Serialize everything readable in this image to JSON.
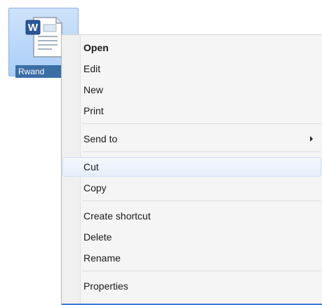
{
  "desktop": {
    "file_label": "Rwand",
    "icon": "word-document-icon",
    "icon_letter": "W"
  },
  "context_menu": {
    "items": [
      {
        "label": "Open"
      },
      {
        "label": "Edit"
      },
      {
        "label": "New"
      },
      {
        "label": "Print"
      },
      {
        "label": "Send to"
      },
      {
        "label": "Cut"
      },
      {
        "label": "Copy"
      },
      {
        "label": "Create shortcut"
      },
      {
        "label": "Delete"
      },
      {
        "label": "Rename"
      },
      {
        "label": "Properties"
      }
    ],
    "bold_item": "Open",
    "hovered_item": "Cut",
    "submenu_item": "Send to",
    "submenu_icon": "chevron-right-icon"
  },
  "colors": {
    "selection": "#a9cdf7",
    "label_highlight": "#3a6ea5",
    "menu_background": "#f5f5f5",
    "accent_line": "#3a7bd5"
  }
}
